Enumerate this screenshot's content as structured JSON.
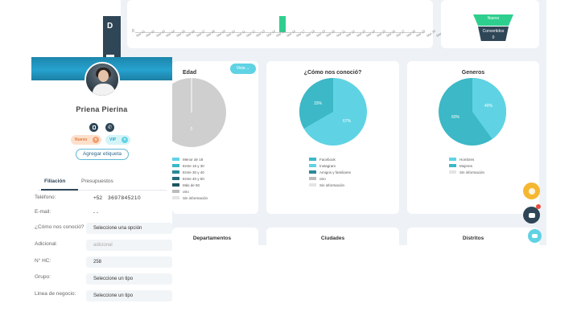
{
  "sidebar": {
    "logo": "D"
  },
  "histogram": {
    "zero_label": "0",
    "dates": [
      "Mar 01",
      "Mar 02",
      "Mar 03",
      "Mar 04",
      "Mar 05",
      "Mar 06",
      "Mar 07",
      "Mar 08",
      "Mar 09",
      "Mar 10",
      "Mar 11",
      "Mar 12",
      "Mar 13",
      "Mar 14",
      "Mar 15",
      "Mar 16",
      "Mar 17",
      "Mar 18",
      "Mar 19",
      "Mar 20",
      "Mar 21",
      "Mar 22",
      "Mar 23",
      "Mar 24",
      "Mar 25",
      "Mar 26",
      "Mar 27",
      "Mar 28",
      "Mar 29",
      "Mar 30",
      "Mar 31"
    ]
  },
  "funnel": {
    "stage1": "Nuevo",
    "stage2": "Convertidos",
    "stage2_value": "0"
  },
  "cards": {
    "edad": {
      "title": "Edad",
      "value_label": "0"
    },
    "vista_button": "Vista",
    "conocio": {
      "title": "¿Cómo nos conoció?",
      "pct_a": "33%",
      "pct_b": "67%"
    },
    "generos": {
      "title": "Generos",
      "pct_a": "60%",
      "pct_b": "40%"
    },
    "departamentos": "Departamentos",
    "ciudades": "Ciudades",
    "distritos": "Distritos"
  },
  "legends": {
    "edad": [
      "Menor de 18",
      "Entre 18 y 30",
      "Entre 30 y 40",
      "Entre 40 y 50",
      "Más de 50",
      "otro",
      "Sin información"
    ],
    "conocio": [
      "Facebook",
      "Instagram",
      "Amigos y familiares",
      "otro",
      "Sin información"
    ],
    "generos": [
      "Hombres",
      "Mujeres",
      "Sin información"
    ]
  },
  "colors": {
    "teal": "#3cb8c6",
    "cyan": "#5fd3e4",
    "gray": "#cfcfcf",
    "light": "#e4e4e4",
    "dark1": "#2a8a99",
    "dark2": "#236d79",
    "dark3": "#1f5560",
    "mid": "#bcbcbc"
  },
  "contact": {
    "name": "Priena Pierina",
    "tags": {
      "nuevo": "Nuevo",
      "vip": "VIP"
    },
    "add_tag": "Agregar etiqueta",
    "tabs": {
      "filiacion": "Filiación",
      "presupuestos": "Presupuestos"
    },
    "fields": {
      "telefono_label": "Teléfono:",
      "telefono_code": "+52",
      "telefono_value": "3697845210",
      "email_label": "E-mail:",
      "email_value": "- -",
      "conocio_label": "¿Cómo nos conoció?",
      "conocio_value": "Seleccione una opción",
      "adicional_label": "Adicional:",
      "adicional_value": "adicional",
      "hc_label": "N° HC:",
      "hc_value": "258",
      "grupo_label": "Grupo:",
      "grupo_value": "Seleccione un tipo",
      "linea_label": "Linea de negocio:",
      "linea_value": "Seleccione un tipo"
    }
  }
}
